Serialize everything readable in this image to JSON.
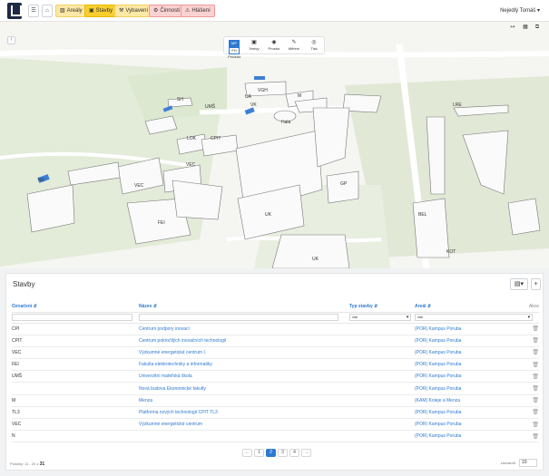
{
  "toolbar": {
    "tabs": [
      {
        "label": "Areály",
        "icon": "car-icon"
      },
      {
        "label": "Stavby",
        "icon": "building-icon"
      },
      {
        "label": "Vybavení",
        "icon": "equipment-icon"
      },
      {
        "label": "Činnosti",
        "icon": "gear-icon"
      },
      {
        "label": "Hlášení",
        "icon": "warning-icon"
      }
    ],
    "user": "Nejedlý Tomáš"
  },
  "map": {
    "toolbar": {
      "mode_options": [
        "MP",
        "FH"
      ],
      "produkt_label": "Produkt",
      "items": [
        "Vrstvy",
        "Prostor",
        "Měření",
        "Tisk"
      ]
    },
    "labels": [
      "VGH",
      "M",
      "SH",
      "UMŠ",
      "VK",
      "CPIT",
      "LOK",
      "VEC",
      "NV",
      "VEC",
      "GP",
      "FEI",
      "UK",
      "UK",
      "LRE",
      "BEL",
      "KOT",
      "Hala",
      "UA"
    ]
  },
  "panel": {
    "title": "Stavby",
    "columns": [
      "Označení",
      "Název",
      "Typ stavby",
      "Areál",
      "Akce"
    ],
    "filters": {
      "typ": "vše",
      "areal": "vše"
    },
    "rows": [
      {
        "code": "CPI",
        "name": "Centrum podpory inovací",
        "area": "(POR) Kampus Poruba"
      },
      {
        "code": "CPIT",
        "name": "Centrum pokročilých inovačních technologií",
        "area": "(POR) Kampus Poruba"
      },
      {
        "code": "VEC",
        "name": "Výzkumné energetické centrum I.",
        "area": "(POR) Kampus Poruba"
      },
      {
        "code": "FEI",
        "name": "Fakulta elektrotechniky a informatiky",
        "area": "(POR) Kampus Poruba"
      },
      {
        "code": "UMŠ",
        "name": "Univerzitní mateřská škola",
        "area": "(POR) Kampus Poruba"
      },
      {
        "code": "",
        "name": "Nová budova Ekonomické fakulty",
        "area": "(POR) Kampus Poruba"
      },
      {
        "code": "M",
        "name": "Menza",
        "area": "(KAM) Koleje a Menza"
      },
      {
        "code": "TL3",
        "name": "Platforma nových technologií CPIT TL3",
        "area": "(POR) Kampus Poruba"
      },
      {
        "code": "VEC",
        "name": "Výzkumné energetické centrum",
        "area": "(POR) Kampus Poruba"
      },
      {
        "code": "N",
        "name": "",
        "area": "(POR) Kampus Poruba"
      }
    ],
    "pagination": {
      "pages": [
        "1",
        "2",
        "3",
        "4"
      ],
      "active": "2"
    },
    "footer": {
      "range": "Položky: 11 - 20 z",
      "total": "31",
      "per_page_label": "záznamů:",
      "per_page": "10"
    }
  }
}
